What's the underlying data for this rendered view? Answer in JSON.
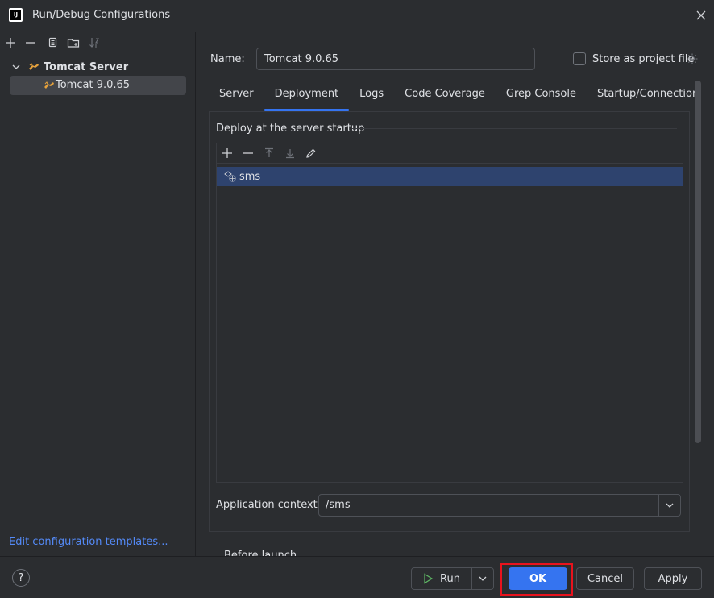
{
  "window": {
    "title": "Run/Debug Configurations",
    "app_icon_text": "IJ"
  },
  "left_panel": {
    "tree": {
      "group_label": "Tomcat Server",
      "selected_item": "Tomcat 9.0.65"
    },
    "edit_templates_link": "Edit configuration templates..."
  },
  "config": {
    "name_label": "Name:",
    "name_value": "Tomcat 9.0.65",
    "store_as_project_file": "Store as project file",
    "store_checked": false
  },
  "tabs": [
    {
      "label": "Server",
      "active": false
    },
    {
      "label": "Deployment",
      "active": true
    },
    {
      "label": "Logs",
      "active": false
    },
    {
      "label": "Code Coverage",
      "active": false
    },
    {
      "label": "Grep Console",
      "active": false
    },
    {
      "label": "Startup/Connection",
      "active": false
    }
  ],
  "deployment": {
    "section_title": "Deploy at the server startup",
    "artifacts": [
      {
        "label": "sms"
      }
    ],
    "app_context_label": "Application context:",
    "app_context_value": "/sms",
    "peek_text": "Before launch"
  },
  "footer": {
    "help_label": "?",
    "run_label": "Run",
    "ok_label": "OK",
    "cancel_label": "Cancel",
    "apply_label": "Apply"
  },
  "colors": {
    "background": "#2b2d30",
    "accent": "#3574f0",
    "selection": "#2e436e",
    "link": "#548af7",
    "highlight_annotation": "#e8131d",
    "tomcat_icon": "#e6a23c"
  }
}
